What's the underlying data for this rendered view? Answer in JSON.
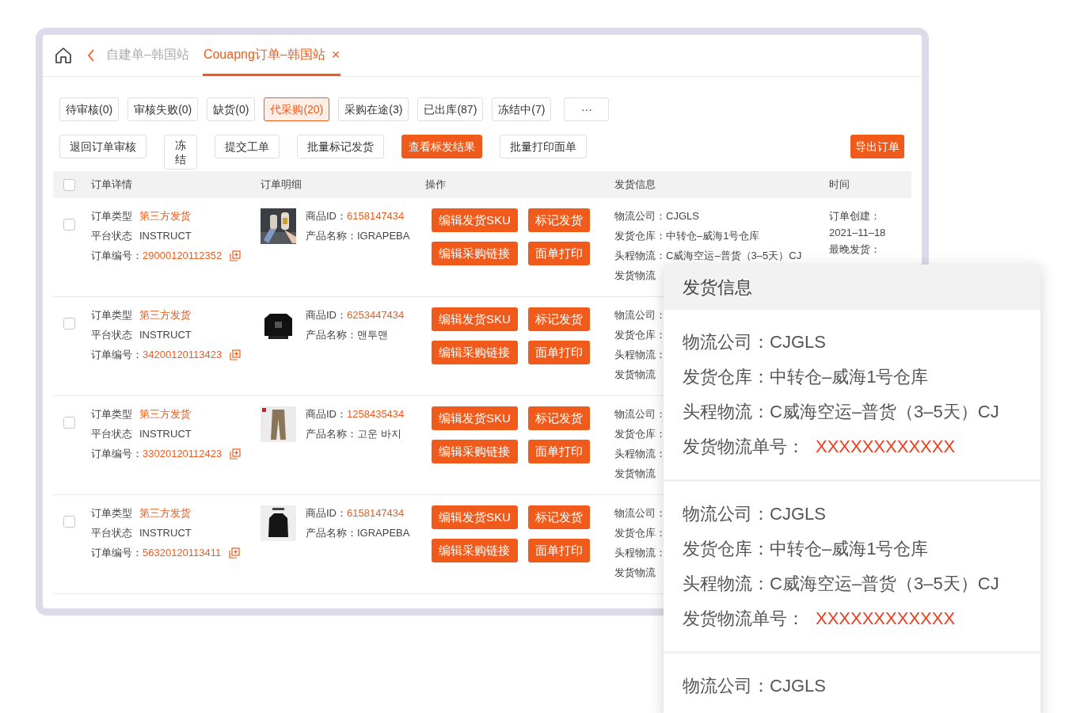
{
  "breadcrumb": {
    "tabs": [
      {
        "label": "自建单–韩国站",
        "selected": false
      },
      {
        "label": "Couapng订单–韩国站",
        "selected": true
      }
    ],
    "close": "×"
  },
  "status_filters": [
    {
      "label": "待审核(0)",
      "selected": false
    },
    {
      "label": "审核失败(0)",
      "selected": false
    },
    {
      "label": "缺货(0)",
      "selected": false
    },
    {
      "label": "代采购(20)",
      "selected": true
    },
    {
      "label": "采购在途(3)",
      "selected": false
    },
    {
      "label": "已出库(87)",
      "selected": false
    },
    {
      "label": "冻结中(7)",
      "selected": false
    },
    {
      "label": "···",
      "selected": false
    }
  ],
  "actions": [
    {
      "label": "退回订单审核",
      "kind": "outline"
    },
    {
      "label": "冻结",
      "kind": "narrow"
    },
    {
      "label": "提交工单",
      "kind": "outline"
    },
    {
      "label": "批量标记发货",
      "kind": "outline"
    },
    {
      "label": "查看标发结果",
      "kind": "primary"
    },
    {
      "label": "批量打印面单",
      "kind": "outline"
    }
  ],
  "export_button": "导出订单",
  "table": {
    "select_all": {
      "checked": false
    },
    "columns": [
      "订单详情",
      "订单明细",
      "操作",
      "发货信息",
      "时间"
    ],
    "rows": [
      {
        "checked": false,
        "type_label": "订单类型",
        "type": "第三方发货",
        "status_label": "平台状态",
        "status": "INSTRUCT",
        "order_no_label": "订单编号：",
        "order_no": "29000120112352",
        "thumbnail": {
          "kind": "picture"
        },
        "product_id_label": "商品ID：",
        "product_id": "6158147434",
        "product_name_label": "产品名称：",
        "product_name": "IGRAPEBA",
        "buttons": [
          "编辑发货SKU",
          "标记发货",
          "编辑采购链接",
          "面单打印"
        ],
        "shipping": [
          "物流公司：CJGLS",
          "发货仓库：中转仓–威海1号仓库",
          "头程物流：C威海空运–普货（3–5天）CJ",
          "发货物流"
        ],
        "time": [
          "订单创建：",
          "2021–11–18",
          "最晚发货："
        ]
      },
      {
        "checked": false,
        "type_label": "订单类型",
        "type": "第三方发货",
        "status_label": "平台状态",
        "status": "INSTRUCT",
        "order_no_label": "订单编号：",
        "order_no": "34200120113423",
        "thumbnail": {
          "kind": "picture"
        },
        "product_id_label": "商品ID：",
        "product_id": "6253447434",
        "product_name_label": "产品名称：",
        "product_name": "맨투맨",
        "buttons": [
          "编辑发货SKU",
          "标记发货",
          "编辑采购链接",
          "面单打印"
        ],
        "shipping": [
          "物流公司：",
          "发货仓库：",
          "头程物流：",
          "发货物流"
        ]
      },
      {
        "checked": false,
        "type_label": "订单类型",
        "type": "第三方发货",
        "status_label": "平台状态",
        "status": "INSTRUCT",
        "order_no_label": "订单编号：",
        "order_no": "33020120112423",
        "thumbnail": {
          "kind": "picture"
        },
        "product_id_label": "商品ID：",
        "product_id": "1258435434",
        "product_name_label": "产品名称：",
        "product_name": "고운 바지",
        "buttons": [
          "编辑发货SKU",
          "标记发货",
          "编辑采购链接",
          "面单打印"
        ],
        "shipping": [
          "物流公司：",
          "发货仓库：",
          "头程物流：",
          "发货物流"
        ]
      },
      {
        "checked": false,
        "type_label": "订单类型",
        "type": "第三方发货",
        "status_label": "平台状态",
        "status": "INSTRUCT",
        "order_no_label": "订单编号：",
        "order_no": "56320120113411",
        "thumbnail": {
          "kind": "picture"
        },
        "product_id_label": "商品ID：",
        "product_id": "6158147434",
        "product_name_label": "产品名称：",
        "product_name": "IGRAPEBA",
        "buttons": [
          "编辑发货SKU",
          "标记发货",
          "编辑采购链接",
          "面单打印"
        ],
        "shipping": [
          "物流公司：",
          "发货仓库：",
          "头程物流：",
          "发货物流"
        ]
      }
    ]
  },
  "popup": {
    "title": "发货信息",
    "sections": [
      {
        "lines": [
          {
            "label": "物流公司：",
            "value": "CJGLS"
          },
          {
            "label": "发货仓库：",
            "value": "中转仓–威海1号仓库"
          },
          {
            "label": "头程物流：",
            "value": "C威海空运–普货（3–5天）CJ"
          },
          {
            "label": "发货物流单号：",
            "value": "XXXXXXXXXXXX",
            "kind": "highlight"
          }
        ]
      },
      {
        "lines": [
          {
            "label": "物流公司：",
            "value": "CJGLS"
          },
          {
            "label": "发货仓库：",
            "value": "中转仓–威海1号仓库"
          },
          {
            "label": "头程物流：",
            "value": "C威海空运–普货（3–5天）CJ"
          },
          {
            "label": "发货物流单号：",
            "value": "XXXXXXXXXXXX",
            "kind": "highlight"
          }
        ]
      },
      {
        "lines": [
          {
            "label": "物流公司：",
            "value": "CJGLS"
          }
        ]
      }
    ]
  }
}
